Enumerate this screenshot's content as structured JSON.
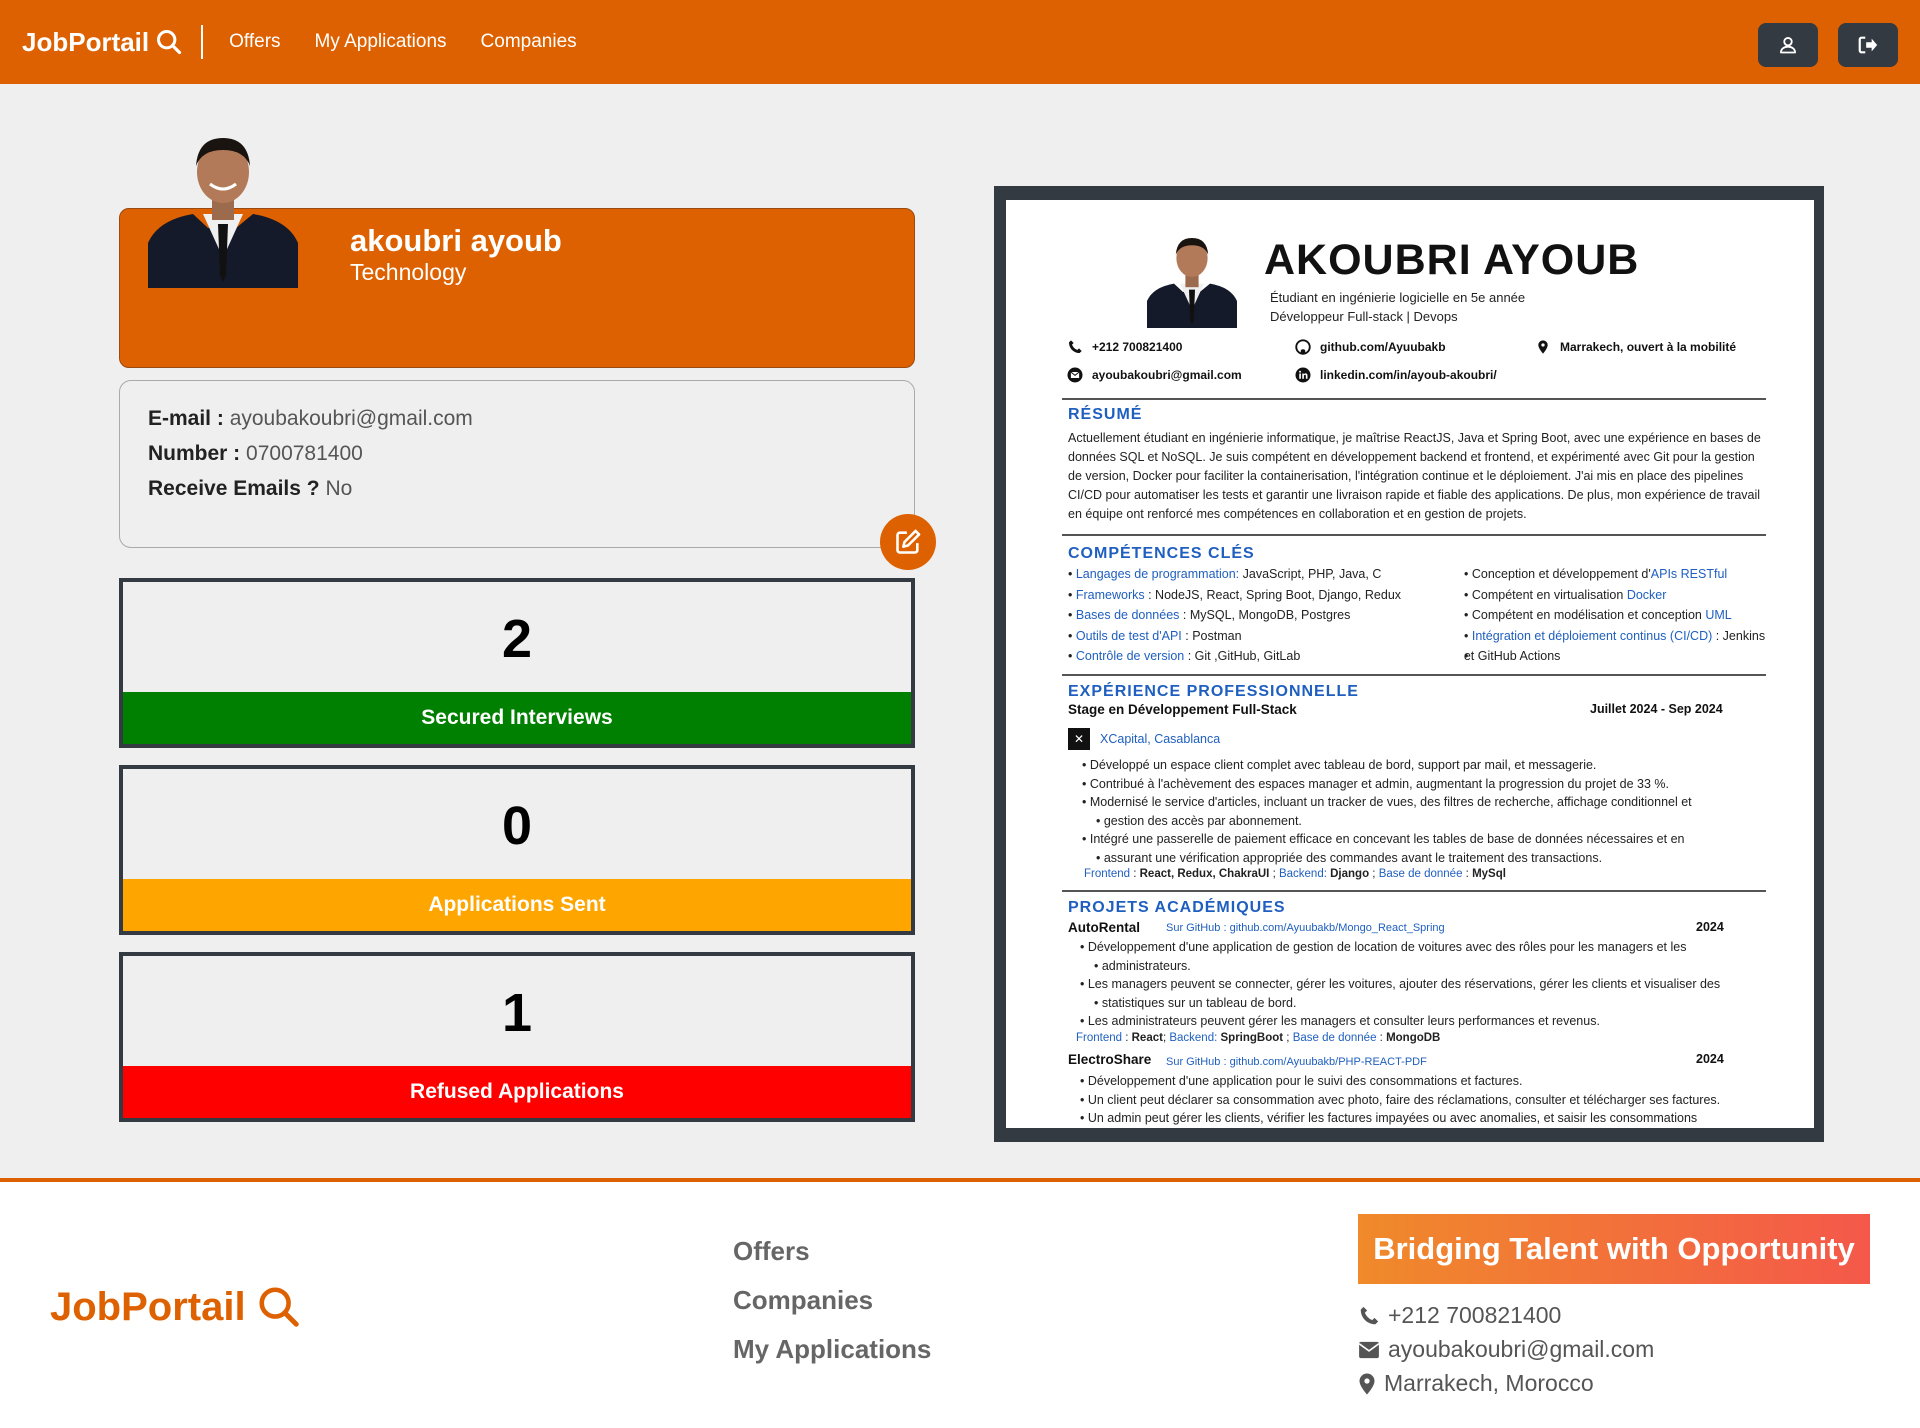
{
  "navbar": {
    "brand": "JobPortail",
    "links": [
      "Offers",
      "My Applications",
      "Companies"
    ],
    "right_icons": [
      "user-icon",
      "sign-out-icon"
    ]
  },
  "profile": {
    "name": "akoubri ayoub",
    "role": "Technology",
    "email_label": "E-mail :",
    "email": "ayoubakoubri@gmail.com",
    "number_label": "Number :",
    "number": "0700781400",
    "receive_label": "Receive Emails ?",
    "receive": "No"
  },
  "stats": [
    {
      "value": "2",
      "label": "Secured Interviews",
      "color": "#008000"
    },
    {
      "value": "0",
      "label": "Applications Sent",
      "color": "#ffa500"
    },
    {
      "value": "1",
      "label": "Refused Applications",
      "color": "#ff0000"
    }
  ],
  "resume": {
    "name": "AKOUBRI AYOUB",
    "subtitle1": "Étudiant en ingénierie logicielle en 5e année",
    "subtitle2": "Développeur Full-stack | Devops",
    "phone": "+212 700821400",
    "github": "github.com/Ayuubakb",
    "location": "Marrakech, ouvert à la mobilité",
    "email": "ayoubakoubri@gmail.com",
    "linkedin": "linkedin.com/in/ayoub-akoubri/",
    "resume_head": "RÉSUMÉ",
    "resume_text": "Actuellement étudiant en ingénierie informatique, je maîtrise ReactJS, Java et Spring Boot, avec une expérience en bases de données SQL et NoSQL. Je suis compétent en développement backend et frontend, et expérimenté avec Git pour la gestion de version, Docker pour faciliter la containerisation, l'intégration continue et le déploiement. J'ai mis en place des pipelines CI/CD pour automatiser les tests et garantir une livraison rapide et fiable des applications. De plus, mon expérience de travail en équipe ont renforcé mes compétences en collaboration et en gestion de projets.",
    "skills_head": "COMPÉTENCES CLÉS",
    "skills_left": [
      {
        "k": "Langages de programmation:",
        "v": " JavaScript, PHP, Java, C"
      },
      {
        "k": "Frameworks",
        "v": " : NodeJS, React, Spring Boot, Django, Redux"
      },
      {
        "k": "Bases de données",
        "v": " : MySQL, MongoDB, Postgres"
      },
      {
        "k": "Outils de test d'API",
        "v": " : Postman"
      },
      {
        "k": "Contrôle de version",
        "v": " : Git ,GitHub, GitLab"
      }
    ],
    "skills_right": [
      {
        "a": "Conception et développement d'",
        "k": "APIs RESTful",
        "b": ""
      },
      {
        "a": "Compétent en virtualisation ",
        "k": "Docker",
        "b": ""
      },
      {
        "a": "Compétent en modélisation et conception ",
        "k": "UML",
        "b": ""
      },
      {
        "a": "",
        "k": "Intégration et déploiement continus (CI/CD)",
        "b": " : Jenkins"
      },
      {
        "a": "et GitHub Actions",
        "k": "",
        "b": ""
      }
    ],
    "exp_head": "EXPÉRIENCE PROFESSIONNELLE",
    "exp_title": "Stage en Développement Full-Stack",
    "exp_date": "Juillet 2024 - Sep 2024",
    "exp_company": "XCapital, Casablanca",
    "exp_items": [
      "Développé un espace client complet avec tableau de bord, support par mail, et messagerie.",
      "Contribué à l'achèvement des espaces manager et admin, augmentant la progression du projet de 33 %.",
      "Modernisé le service d'articles, incluant un tracker de vues, des filtres de recherche, affichage conditionnel et",
      "Intégré une passerelle de paiement efficace en concevant les tables de base de données nécessaires et en"
    ],
    "exp_item3_cont": "gestion des accès par abonnement.",
    "exp_item4_cont": "assurant une vérification appropriée des commandes avant le traitement des transactions.",
    "exp_tech": {
      "f": "Frontend",
      "fv": "React, Redux, ChakraUI",
      "b": "Backend:",
      "bv": "Django",
      "d": "Base de donnée",
      "dv": "MySql"
    },
    "proj_head": "PROJETS ACADÉMIQUES",
    "proj1_title": "AutoRental",
    "proj1_link": "Sur GitHub : github.com/Ayuubakb/Mongo_React_Spring",
    "proj1_year": "2024",
    "proj1_items": [
      "Développement d'une application de gestion de location de voitures avec des rôles pour les managers et les",
      "Les managers peuvent se connecter, gérer les voitures, ajouter des réservations, gérer les clients et visualiser des",
      "Les administrateurs peuvent gérer les managers et consulter leurs performances et revenus."
    ],
    "proj1_item1_cont": "administrateurs.",
    "proj1_item2_cont": "statistiques sur un tableau de bord.",
    "proj1_tech": {
      "f": "Frontend",
      "fv": "React",
      "b": "Backend:",
      "bv": "SpringBoot",
      "d": "Base de donnée",
      "dv": "MongoDB"
    },
    "proj2_title": "ElectroShare",
    "proj2_link": "Sur GitHub : github.com/Ayuubakb/PHP-REACT-PDF",
    "proj2_year": "2024",
    "proj2_items": [
      "Développement d'une application pour le suivi des consommations et factures.",
      "Un client peut déclarer sa consommation avec photo, faire des réclamations, consulter et télécharger ses factures.",
      "Un admin peut gérer les clients, vérifier les factures impayées ou avec anomalies, et saisir les consommations"
    ]
  },
  "footer": {
    "brand": "JobPortail",
    "links": [
      "Offers",
      "Companies",
      "My Applications"
    ],
    "banner": "Bridging Talent with Opportunity",
    "phone": "+212 700821400",
    "email": "ayoubakoubri@gmail.com",
    "location": "Marrakech, Morocco"
  },
  "colors": {
    "accent": "#de6100",
    "dark": "#333a42"
  }
}
